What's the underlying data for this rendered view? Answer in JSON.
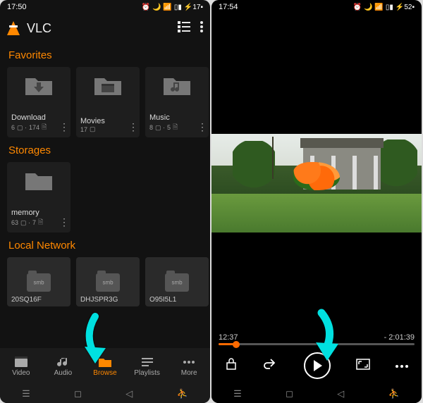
{
  "left": {
    "status": {
      "time": "17:50",
      "battery": "17",
      "icons": "⏰ 🌙 📶 📶"
    },
    "app_title": "VLC",
    "sections": {
      "favorites_title": "Favorites",
      "storages_title": "Storages",
      "local_network_title": "Local Network"
    },
    "favorites": [
      {
        "name": "Download",
        "folders": "6",
        "files": "174",
        "icon": "download-folder"
      },
      {
        "name": "Movies",
        "folders": "17",
        "files": "",
        "icon": "clapper-folder"
      },
      {
        "name": "Music",
        "folders": "8",
        "files": "5",
        "icon": "music-folder"
      }
    ],
    "storages": [
      {
        "name": "memory",
        "folders": "63",
        "files": "7"
      }
    ],
    "local_network": [
      {
        "name": "20SQ16F",
        "proto": "smb"
      },
      {
        "name": "DHJSPR3G",
        "proto": "smb"
      },
      {
        "name": "O95I5L1",
        "proto": "smb"
      }
    ],
    "nav": {
      "video": "Video",
      "audio": "Audio",
      "browse": "Browse",
      "playlists": "Playlists",
      "more": "More"
    }
  },
  "right": {
    "status": {
      "time": "17:54",
      "battery": "52",
      "icons": "⏰ 🌙 📶 📶"
    },
    "elapsed": "12:37",
    "remaining": "- 2:01:39"
  }
}
